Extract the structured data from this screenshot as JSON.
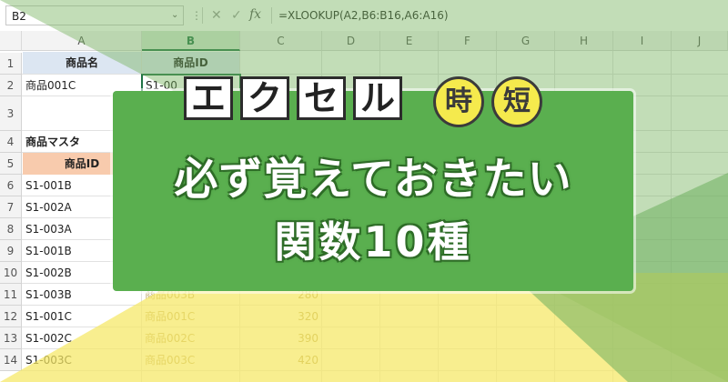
{
  "formula_bar": {
    "name_box": "B2",
    "name_box_arrow": "⌄",
    "dots": "⋮",
    "cancel_icon": "✕",
    "enter_icon": "✓",
    "fx_label": "fx",
    "formula": "=XLOOKUP(A2,B6:B16,A6:A16)"
  },
  "columns": [
    "A",
    "B",
    "C",
    "D",
    "E",
    "F",
    "G",
    "H",
    "I",
    "J"
  ],
  "rows": [
    "1",
    "2",
    "3",
    "4",
    "5",
    "6",
    "7",
    "8",
    "9",
    "10",
    "11",
    "12",
    "13",
    "14"
  ],
  "cells": {
    "a1": "商品名",
    "b1": "商品ID",
    "a2": "商品001C",
    "b2": "S1-00",
    "a4": "商品マスタ",
    "a5": "商品ID",
    "a6": "S1-001B",
    "a7": "S1-002A",
    "a8": "S1-003A",
    "a9": "S1-001B",
    "a10": "S1-002B",
    "a11": "S1-003B",
    "b11": "商品003B",
    "c11": "280",
    "a12": "S1-001C",
    "b12": "商品001C",
    "c12": "320",
    "a13": "S1-002C",
    "b13": "商品002C",
    "c13": "390",
    "a14": "S1-003C",
    "b14": "商品003C",
    "c14": "420"
  },
  "banner": {
    "chars": [
      "エ",
      "ク",
      "セ",
      "ル"
    ],
    "badges": [
      "時",
      "短"
    ],
    "line1": "必ず覚えておきたい",
    "line2": "関数10種"
  },
  "colors": {
    "banner_green": "#5aaf4f",
    "badge_yellow": "#f5ea4d",
    "excel_green": "#217346"
  }
}
